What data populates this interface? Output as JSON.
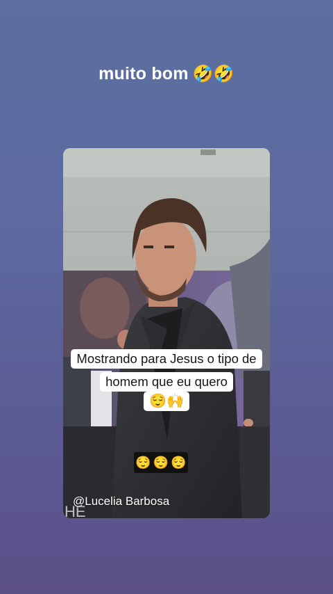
{
  "story": {
    "caption_text": "muito bom",
    "caption_emoji": "🤣🤣"
  },
  "video": {
    "caption_line1": "Mostrando para Jesus o tipo de",
    "caption_line2": "homem que eu quero",
    "caption_emoji": "😌🙌",
    "emoji_strip": [
      "😌",
      "😌",
      "😌"
    ],
    "watermark": "@Lucelia Barbosa"
  }
}
